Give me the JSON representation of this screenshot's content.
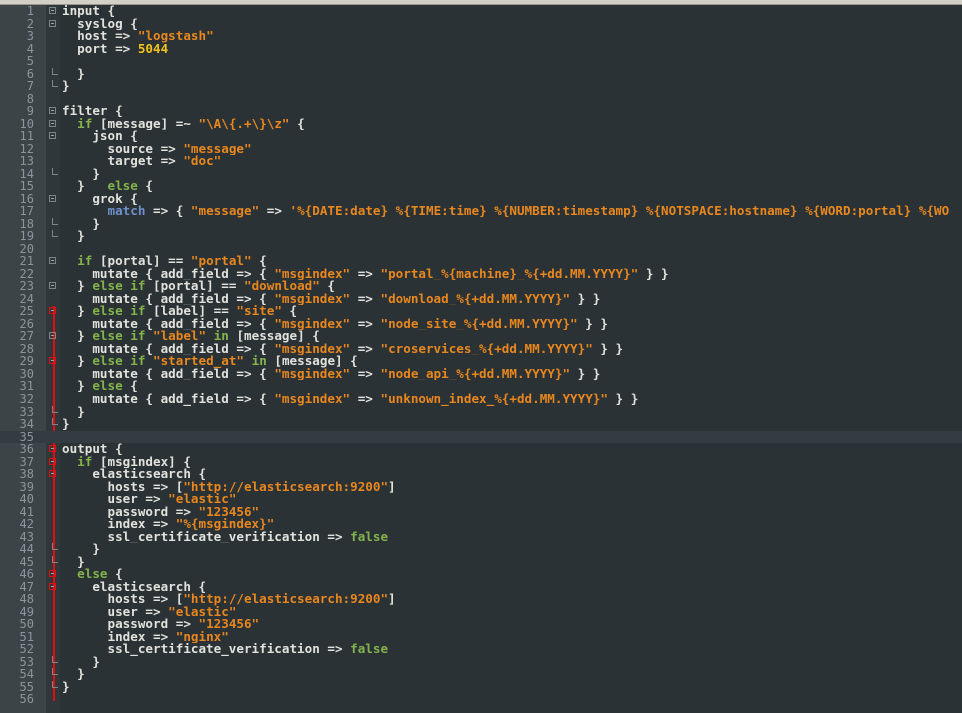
{
  "colors": {
    "background": "#2b3236",
    "keyword": "#83b34a",
    "string": "#e8871e",
    "number": "#f2c21c",
    "function": "#6d8fc9",
    "change_marker": "#e01010"
  },
  "current_line": 35,
  "lines": [
    {
      "n": "1",
      "fold": "open",
      "tokens": [
        [
          "t",
          "input {"
        ]
      ]
    },
    {
      "n": "2",
      "fold": "open",
      "tokens": [
        [
          "t",
          "  syslog {"
        ]
      ]
    },
    {
      "n": "3",
      "fold": "",
      "tokens": [
        [
          "t",
          "  host => "
        ],
        [
          "s",
          "\"logstash\""
        ]
      ]
    },
    {
      "n": "4",
      "fold": "",
      "tokens": [
        [
          "t",
          "  port => "
        ],
        [
          "n",
          "5044"
        ]
      ]
    },
    {
      "n": "5",
      "fold": "",
      "tokens": []
    },
    {
      "n": "6",
      "fold": "end",
      "tokens": [
        [
          "t",
          "  }"
        ]
      ]
    },
    {
      "n": "7",
      "fold": "end",
      "tokens": [
        [
          "t",
          "}"
        ]
      ]
    },
    {
      "n": "8",
      "fold": "",
      "tokens": []
    },
    {
      "n": "9",
      "fold": "open",
      "tokens": [
        [
          "t",
          "filter {"
        ]
      ]
    },
    {
      "n": "10",
      "fold": "open",
      "tokens": [
        [
          "t",
          "  "
        ],
        [
          "k",
          "if"
        ],
        [
          "t",
          " [message] =~ "
        ],
        [
          "s",
          "\"\\A\\{.+\\}\\z\""
        ],
        [
          "t",
          " {"
        ]
      ]
    },
    {
      "n": "11",
      "fold": "open",
      "tokens": [
        [
          "t",
          "    json {"
        ]
      ]
    },
    {
      "n": "12",
      "fold": "",
      "tokens": [
        [
          "t",
          "      source => "
        ],
        [
          "s",
          "\"message\""
        ]
      ]
    },
    {
      "n": "13",
      "fold": "",
      "tokens": [
        [
          "t",
          "      target => "
        ],
        [
          "s",
          "\"doc\""
        ]
      ]
    },
    {
      "n": "14",
      "fold": "end",
      "tokens": [
        [
          "t",
          "    }"
        ]
      ]
    },
    {
      "n": "15",
      "fold": "",
      "tokens": [
        [
          "t",
          "  }   "
        ],
        [
          "k",
          "else"
        ],
        [
          "t",
          " {"
        ]
      ]
    },
    {
      "n": "16",
      "fold": "open",
      "tokens": [
        [
          "t",
          "    grok {"
        ]
      ]
    },
    {
      "n": "17",
      "fold": "",
      "tokens": [
        [
          "t",
          "      "
        ],
        [
          "f",
          "match"
        ],
        [
          "t",
          " => { "
        ],
        [
          "s",
          "\"message\""
        ],
        [
          "t",
          " => "
        ],
        [
          "s",
          "'%{DATE:date} %{TIME:time} %{NUMBER:timestamp} %{NOTSPACE:hostname} %{WORD:portal} %{WO"
        ]
      ]
    },
    {
      "n": "18",
      "fold": "end",
      "tokens": [
        [
          "t",
          "    }"
        ]
      ]
    },
    {
      "n": "19",
      "fold": "end",
      "tokens": [
        [
          "t",
          "  }"
        ]
      ]
    },
    {
      "n": "20",
      "fold": "",
      "tokens": []
    },
    {
      "n": "21",
      "fold": "open",
      "tokens": [
        [
          "t",
          "  "
        ],
        [
          "k",
          "if"
        ],
        [
          "t",
          " [portal] == "
        ],
        [
          "s",
          "\"portal\""
        ],
        [
          "t",
          " {"
        ]
      ]
    },
    {
      "n": "22",
      "fold": "",
      "tokens": [
        [
          "t",
          "    mutate { add_field => { "
        ],
        [
          "s",
          "\"msgindex\""
        ],
        [
          "t",
          " => "
        ],
        [
          "s",
          "\"portal_%{machine}_%{+dd.MM.YYYY}\""
        ],
        [
          "t",
          " } }"
        ]
      ]
    },
    {
      "n": "23",
      "fold": "open",
      "tokens": [
        [
          "t",
          "  } "
        ],
        [
          "k",
          "else if"
        ],
        [
          "t",
          " [portal] == "
        ],
        [
          "s",
          "\"download\""
        ],
        [
          "t",
          " {"
        ]
      ]
    },
    {
      "n": "24",
      "fold": "",
      "tokens": [
        [
          "t",
          "    mutate { add_field => { "
        ],
        [
          "s",
          "\"msgindex\""
        ],
        [
          "t",
          " => "
        ],
        [
          "s",
          "\"download_%{+dd.MM.YYYY}\""
        ],
        [
          "t",
          " } }"
        ]
      ]
    },
    {
      "n": "25",
      "fold": "open-red",
      "tokens": [
        [
          "t",
          "  } "
        ],
        [
          "k",
          "else if"
        ],
        [
          "t",
          " [label] == "
        ],
        [
          "s",
          "\"site\""
        ],
        [
          "t",
          " {"
        ]
      ]
    },
    {
      "n": "26",
      "fold": "",
      "tokens": [
        [
          "t",
          "    mutate { add_field => { "
        ],
        [
          "s",
          "\"msgindex\""
        ],
        [
          "t",
          " => "
        ],
        [
          "s",
          "\"node_site_%{+dd.MM.YYYY}\""
        ],
        [
          "t",
          " } }"
        ]
      ]
    },
    {
      "n": "27",
      "fold": "open",
      "tokens": [
        [
          "t",
          "  } "
        ],
        [
          "k",
          "else if"
        ],
        [
          "t",
          " "
        ],
        [
          "s",
          "\"label\""
        ],
        [
          "t",
          " "
        ],
        [
          "k",
          "in"
        ],
        [
          "t",
          " [message] {"
        ]
      ]
    },
    {
      "n": "28",
      "fold": "",
      "tokens": [
        [
          "t",
          "    mutate { add_field => { "
        ],
        [
          "s",
          "\"msgindex\""
        ],
        [
          "t",
          " => "
        ],
        [
          "s",
          "\"croservices_%{+dd.MM.YYYY}\""
        ],
        [
          "t",
          " } }"
        ]
      ]
    },
    {
      "n": "29",
      "fold": "open-red",
      "tokens": [
        [
          "t",
          "  } "
        ],
        [
          "k",
          "else if"
        ],
        [
          "t",
          " "
        ],
        [
          "s",
          "\"started_at\""
        ],
        [
          "t",
          " "
        ],
        [
          "k",
          "in"
        ],
        [
          "t",
          " [message] {"
        ]
      ]
    },
    {
      "n": "30",
      "fold": "",
      "tokens": [
        [
          "t",
          "    mutate { add_field => { "
        ],
        [
          "s",
          "\"msgindex\""
        ],
        [
          "t",
          " => "
        ],
        [
          "s",
          "\"node_api_%{+dd.MM.YYYY}\""
        ],
        [
          "t",
          " } }"
        ]
      ]
    },
    {
      "n": "31",
      "fold": "",
      "tokens": [
        [
          "t",
          "  } "
        ],
        [
          "k",
          "else"
        ],
        [
          "t",
          " {"
        ]
      ]
    },
    {
      "n": "32",
      "fold": "",
      "tokens": [
        [
          "t",
          "    mutate { add_field => { "
        ],
        [
          "s",
          "\"msgindex\""
        ],
        [
          "t",
          " => "
        ],
        [
          "s",
          "\"unknown_index_%{+dd.MM.YYYY}\""
        ],
        [
          "t",
          " } }"
        ]
      ]
    },
    {
      "n": "33",
      "fold": "end",
      "tokens": [
        [
          "t",
          "  }"
        ]
      ]
    },
    {
      "n": "34",
      "fold": "end",
      "tokens": [
        [
          "t",
          "}"
        ]
      ]
    },
    {
      "n": "35",
      "fold": "",
      "tokens": []
    },
    {
      "n": "36",
      "fold": "open-red",
      "tokens": [
        [
          "t",
          "output {"
        ]
      ]
    },
    {
      "n": "37",
      "fold": "open-red",
      "tokens": [
        [
          "t",
          "  "
        ],
        [
          "k",
          "if"
        ],
        [
          "t",
          " [msgindex] {"
        ]
      ]
    },
    {
      "n": "38",
      "fold": "open-red",
      "tokens": [
        [
          "t",
          "    elasticsearch {"
        ]
      ]
    },
    {
      "n": "39",
      "fold": "",
      "tokens": [
        [
          "t",
          "      hosts => ["
        ],
        [
          "s",
          "\"http://elasticsearch:9200\""
        ],
        [
          "t",
          "]"
        ]
      ]
    },
    {
      "n": "40",
      "fold": "",
      "tokens": [
        [
          "t",
          "      user => "
        ],
        [
          "s",
          "\"elastic\""
        ]
      ]
    },
    {
      "n": "41",
      "fold": "",
      "tokens": [
        [
          "t",
          "      password => "
        ],
        [
          "s",
          "\"123456\""
        ]
      ]
    },
    {
      "n": "42",
      "fold": "",
      "tokens": [
        [
          "t",
          "      index => "
        ],
        [
          "s",
          "\"%{msgindex}\""
        ]
      ]
    },
    {
      "n": "43",
      "fold": "",
      "tokens": [
        [
          "t",
          "      ssl_certificate_verification => "
        ],
        [
          "k",
          "false"
        ]
      ]
    },
    {
      "n": "44",
      "fold": "end",
      "tokens": [
        [
          "t",
          "    }"
        ]
      ]
    },
    {
      "n": "45",
      "fold": "end",
      "tokens": [
        [
          "t",
          "  }"
        ]
      ]
    },
    {
      "n": "46",
      "fold": "open-red",
      "tokens": [
        [
          "t",
          "  "
        ],
        [
          "k",
          "else"
        ],
        [
          "t",
          " {"
        ]
      ]
    },
    {
      "n": "47",
      "fold": "open-red",
      "tokens": [
        [
          "t",
          "    elasticsearch {"
        ]
      ]
    },
    {
      "n": "48",
      "fold": "",
      "tokens": [
        [
          "t",
          "      hosts => ["
        ],
        [
          "s",
          "\"http://elasticsearch:9200\""
        ],
        [
          "t",
          "]"
        ]
      ]
    },
    {
      "n": "49",
      "fold": "",
      "tokens": [
        [
          "t",
          "      user => "
        ],
        [
          "s",
          "\"elastic\""
        ]
      ]
    },
    {
      "n": "50",
      "fold": "",
      "tokens": [
        [
          "t",
          "      password => "
        ],
        [
          "s",
          "\"123456\""
        ]
      ]
    },
    {
      "n": "51",
      "fold": "",
      "tokens": [
        [
          "t",
          "      index => "
        ],
        [
          "s",
          "\"nginx\""
        ]
      ]
    },
    {
      "n": "52",
      "fold": "",
      "tokens": [
        [
          "t",
          "      ssl_certificate_verification => "
        ],
        [
          "k",
          "false"
        ]
      ]
    },
    {
      "n": "53",
      "fold": "end",
      "tokens": [
        [
          "t",
          "    }"
        ]
      ]
    },
    {
      "n": "54",
      "fold": "end",
      "tokens": [
        [
          "t",
          "  }"
        ]
      ]
    },
    {
      "n": "55",
      "fold": "end",
      "tokens": [
        [
          "t",
          "}"
        ]
      ]
    },
    {
      "n": "56",
      "fold": "",
      "tokens": []
    }
  ]
}
